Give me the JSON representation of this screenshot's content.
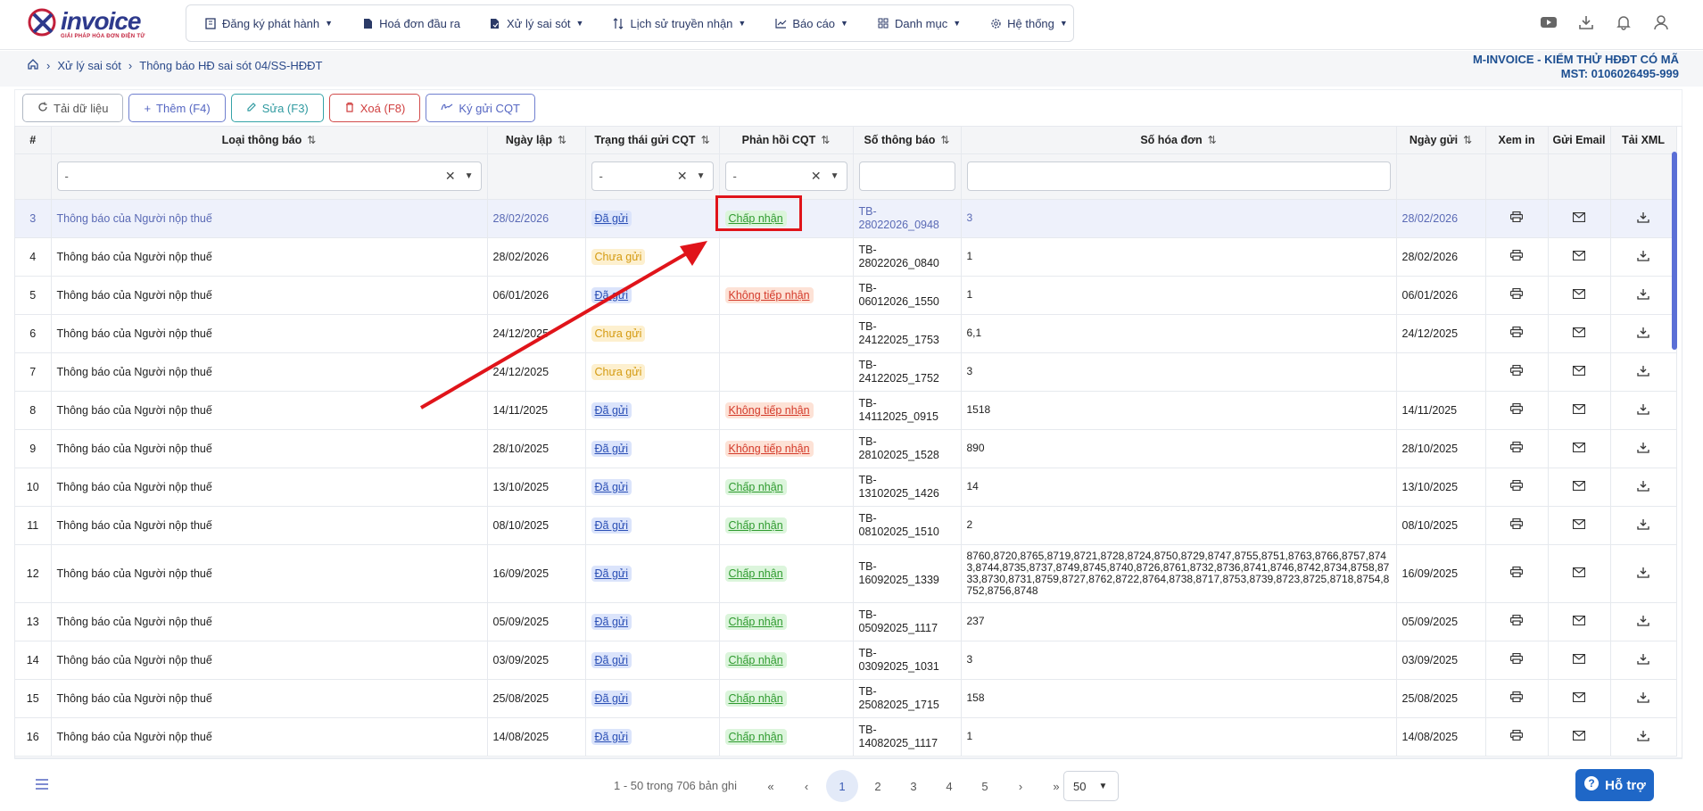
{
  "brand": {
    "name": "invoice",
    "tagline": "GIẢI PHÁP HÓA ĐƠN ĐIỆN TỬ"
  },
  "nav": [
    {
      "label": "Đăng ký phát hành",
      "icon": "building-icon",
      "has_menu": true
    },
    {
      "label": "Hoá đơn đầu ra",
      "icon": "document-icon",
      "has_menu": false
    },
    {
      "label": "Xử lý sai sót",
      "icon": "document-check-icon",
      "has_menu": true
    },
    {
      "label": "Lịch sử truyền nhận",
      "icon": "sort-arrows-icon",
      "has_menu": true
    },
    {
      "label": "Báo cáo",
      "icon": "chart-icon",
      "has_menu": true
    },
    {
      "label": "Danh mục",
      "icon": "grid-icon",
      "has_menu": true
    },
    {
      "label": "Hệ thống",
      "icon": "gear-icon",
      "has_menu": true
    }
  ],
  "breadcrumb": {
    "level1": "Xử lý sai sót",
    "level2": "Thông báo HĐ sai sót 04/SS-HĐĐT"
  },
  "company": {
    "name": "M-INVOICE - KIỂM THỬ HĐĐT CÓ MÃ",
    "mst": "MST: 0106026495-999"
  },
  "toolbar": {
    "reload": "Tải dữ liệu",
    "add": "Thêm (F4)",
    "edit": "Sửa (F3)",
    "delete": "Xoá (F8)",
    "sign": "Ký gửi CQT"
  },
  "columns": {
    "no": "#",
    "type": "Loại thông báo",
    "date": "Ngày lập",
    "send_status": "Trạng thái gửi CQT",
    "feedback": "Phản hồi CQT",
    "notice_no": "Số thông báo",
    "invoice_no": "Số hóa đơn",
    "sent_date": "Ngày gửi",
    "print": "Xem in",
    "email": "Gửi Email",
    "xml": "Tải XML"
  },
  "filters": {
    "type": "-",
    "send_status": "-",
    "feedback": "-"
  },
  "rows": [
    {
      "no": "3",
      "type": "Thông báo của Người nộp thuế",
      "date": "28/02/2026",
      "status": "Đã gửi",
      "feedback": "Chấp nhận",
      "notice_a": "TB-",
      "notice_b": "28022026_0948",
      "invoices": "3",
      "sent_date": "28/02/2026"
    },
    {
      "no": "4",
      "type": "Thông báo của Người nộp thuế",
      "date": "28/02/2026",
      "status": "Chưa gửi",
      "feedback": "",
      "notice_a": "TB-",
      "notice_b": "28022026_0840",
      "invoices": "1",
      "sent_date": "28/02/2026"
    },
    {
      "no": "5",
      "type": "Thông báo của Người nộp thuế",
      "date": "06/01/2026",
      "status": "Đã gửi",
      "feedback": "Không tiếp nhận",
      "notice_a": "TB-",
      "notice_b": "06012026_1550",
      "invoices": "1",
      "sent_date": "06/01/2026"
    },
    {
      "no": "6",
      "type": "Thông báo của Người nộp thuế",
      "date": "24/12/2025",
      "status": "Chưa gửi",
      "feedback": "",
      "notice_a": "TB-",
      "notice_b": "24122025_1753",
      "invoices": "6,1",
      "sent_date": "24/12/2025"
    },
    {
      "no": "7",
      "type": "Thông báo của Người nộp thuế",
      "date": "24/12/2025",
      "status": "Chưa gửi",
      "feedback": "",
      "notice_a": "TB-",
      "notice_b": "24122025_1752",
      "invoices": "3",
      "sent_date": ""
    },
    {
      "no": "8",
      "type": "Thông báo của Người nộp thuế",
      "date": "14/11/2025",
      "status": "Đã gửi",
      "feedback": "Không tiếp nhận",
      "notice_a": "TB-",
      "notice_b": "14112025_0915",
      "invoices": "1518",
      "sent_date": "14/11/2025"
    },
    {
      "no": "9",
      "type": "Thông báo của Người nộp thuế",
      "date": "28/10/2025",
      "status": "Đã gửi",
      "feedback": "Không tiếp nhận",
      "notice_a": "TB-",
      "notice_b": "28102025_1528",
      "invoices": "890",
      "sent_date": "28/10/2025"
    },
    {
      "no": "10",
      "type": "Thông báo của Người nộp thuế",
      "date": "13/10/2025",
      "status": "Đã gửi",
      "feedback": "Chấp nhận",
      "notice_a": "TB-",
      "notice_b": "13102025_1426",
      "invoices": "14",
      "sent_date": "13/10/2025"
    },
    {
      "no": "11",
      "type": "Thông báo của Người nộp thuế",
      "date": "08/10/2025",
      "status": "Đã gửi",
      "feedback": "Chấp nhận",
      "notice_a": "TB-",
      "notice_b": "08102025_1510",
      "invoices": "2",
      "sent_date": "08/10/2025"
    },
    {
      "no": "12",
      "type": "Thông báo của Người nộp thuế",
      "date": "16/09/2025",
      "status": "Đã gửi",
      "feedback": "Chấp nhận",
      "notice_a": "TB-",
      "notice_b": "16092025_1339",
      "invoices": "8760,8720,8765,8719,8721,8728,8724,8750,8729,8747,8755,8751,8763,8766,8757,8743,8744,8735,8737,8749,8745,8740,8726,8761,8732,8736,8741,8746,8742,8734,8758,8733,8730,8731,8759,8727,8762,8722,8764,8738,8717,8753,8739,8723,8725,8718,8754,8752,8756,8748",
      "sent_date": "16/09/2025"
    },
    {
      "no": "13",
      "type": "Thông báo của Người nộp thuế",
      "date": "05/09/2025",
      "status": "Đã gửi",
      "feedback": "Chấp nhận",
      "notice_a": "TB-",
      "notice_b": "05092025_1117",
      "invoices": "237",
      "sent_date": "05/09/2025"
    },
    {
      "no": "14",
      "type": "Thông báo của Người nộp thuế",
      "date": "03/09/2025",
      "status": "Đã gửi",
      "feedback": "Chấp nhận",
      "notice_a": "TB-",
      "notice_b": "03092025_1031",
      "invoices": "3",
      "sent_date": "03/09/2025"
    },
    {
      "no": "15",
      "type": "Thông báo của Người nộp thuế",
      "date": "25/08/2025",
      "status": "Đã gửi",
      "feedback": "Chấp nhận",
      "notice_a": "TB-",
      "notice_b": "25082025_1715",
      "invoices": "158",
      "sent_date": "25/08/2025"
    },
    {
      "no": "16",
      "type": "Thông báo của Người nộp thuế",
      "date": "14/08/2025",
      "status": "Đã gửi",
      "feedback": "Chấp nhận",
      "notice_a": "TB-14082025_1117",
      "notice_b": "",
      "invoices": "1",
      "sent_date": "14/08/2025"
    }
  ],
  "pagination": {
    "info": "1 - 50 trong 706 bản ghi",
    "pages": [
      "1",
      "2",
      "3",
      "4",
      "5"
    ],
    "current": "1",
    "page_size": "50"
  },
  "help": {
    "label": "Hỗ trợ"
  },
  "colors": {
    "primary": "#1f67c7",
    "annotation": "#e0141a"
  }
}
